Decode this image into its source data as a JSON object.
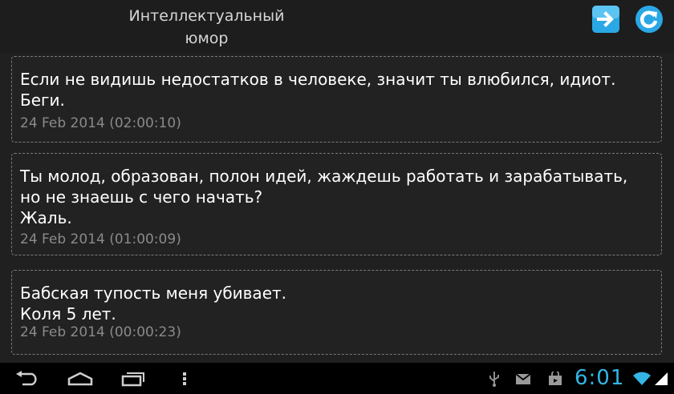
{
  "header": {
    "title": "Интеллектуальный юмор",
    "next_icon": "arrow-right-icon",
    "refresh_icon": "refresh-icon",
    "accent": "#2aa8e6"
  },
  "posts": [
    {
      "text": "Если не видишь недостатков в человеке, значит ты влюбился, идиот.\nБеги.",
      "date": "24 Feb 2014 (02:00:10)"
    },
    {
      "text": "Ты молод, образован, полон идей, жаждешь работать и зарабатывать,\nно не знаешь с чего начать?\nЖаль.",
      "date": "24 Feb 2014 (01:00:09)"
    },
    {
      "text": "Бабская тупость меня убивает.\nКоля 5 лет.",
      "date": "24 Feb 2014 (00:00:23)"
    }
  ],
  "system_bar": {
    "clock": "6:01",
    "clock_color": "#34b5e5",
    "icons": [
      "back-icon",
      "home-icon",
      "recent-apps-icon",
      "menu-icon",
      "usb-icon",
      "gmail-icon",
      "store-icon",
      "wifi-icon"
    ]
  }
}
